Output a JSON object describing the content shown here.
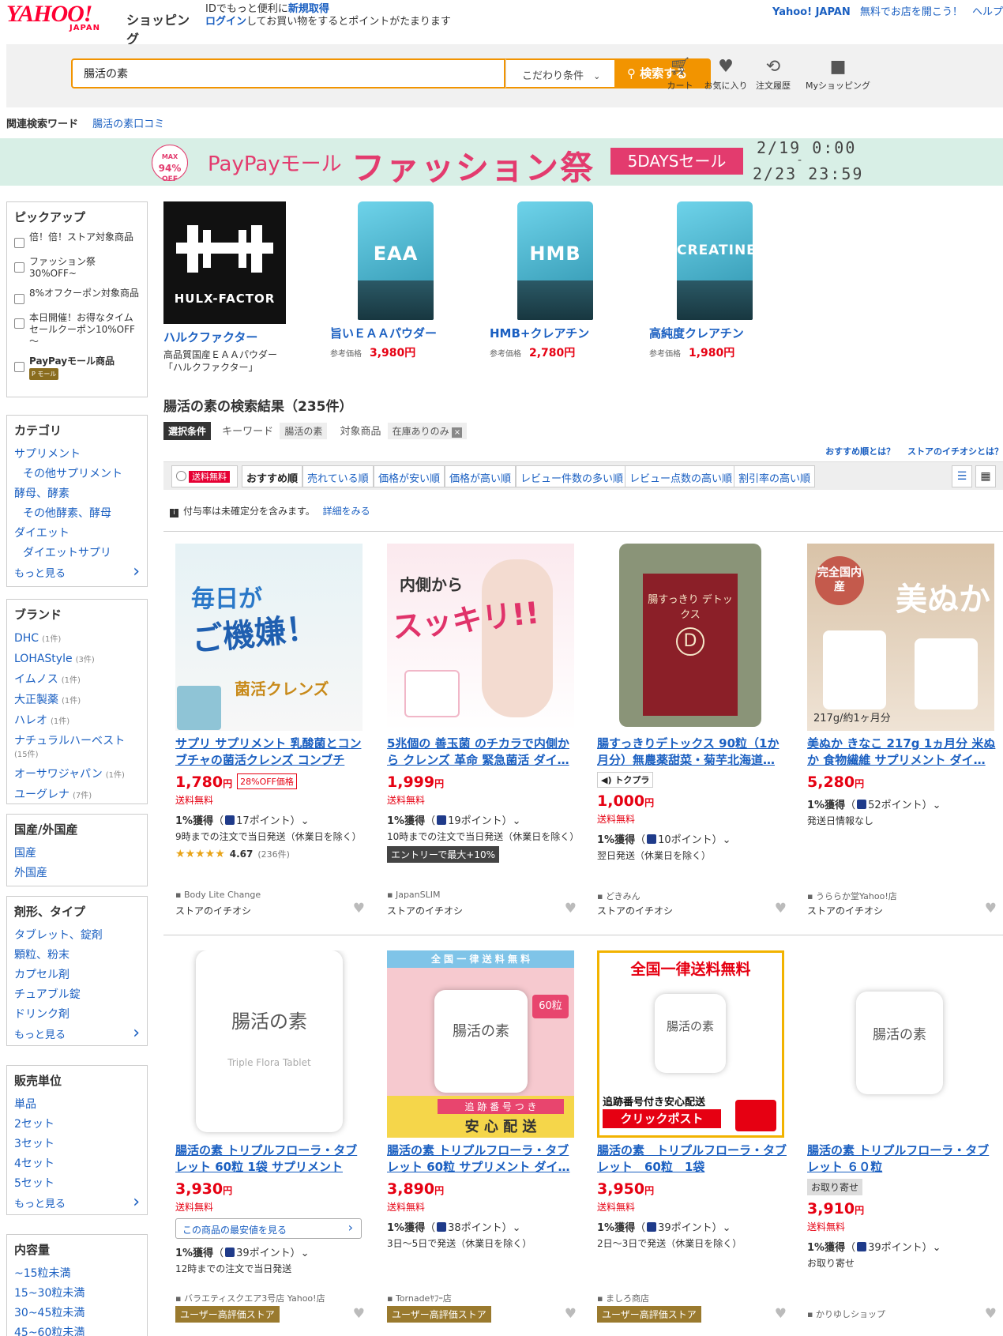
{
  "header": {
    "logo_yahoo": "YAHOO!",
    "logo_japan": "JAPAN",
    "logo_shopping": "ショッピング",
    "promo_line1_pre": "IDでもっと便利に",
    "promo_line1_link": "新規取得",
    "promo_line2_link": "ログイン",
    "promo_line2_post": "してお買い物をするとポイントがたまります",
    "top_links": [
      "Yahoo! JAPAN",
      "無料でお店を開こう！",
      "ヘルプ"
    ]
  },
  "search": {
    "query": "腸活の素",
    "kodawari": "こだわり条件",
    "button": "検索する",
    "icons": [
      {
        "name": "cart-icon",
        "label": "カート"
      },
      {
        "name": "heart-icon",
        "label": "お気に入り"
      },
      {
        "name": "order-history-icon",
        "label": "注文履歴"
      },
      {
        "name": "my-shopping-icon",
        "label": "Myショッピング"
      }
    ]
  },
  "related": {
    "label": "関連検索ワード",
    "word": "腸活の素口コミ"
  },
  "banner": {
    "max": "MAX",
    "pct": "94%",
    "off": "OFF",
    "paypay": "PayPayモール",
    "title": "ファッション祭",
    "sale": "5DAYSセール",
    "date_start": "2/19 0:00",
    "date_sep": "-",
    "date_end": "2/23 23:59"
  },
  "sidebar": {
    "pickup": {
      "title": "ピックアップ",
      "items": [
        "倍！倍！ストア対象商品",
        "ファッション祭30%OFF~",
        "8%オフクーポン対象商品",
        "本日開催！お得なタイムセールクーポン10%OFF～",
        "PayPayモール商品"
      ]
    },
    "category": {
      "title": "カテゴリ",
      "items": [
        {
          "label": "サプリメント",
          "sub": false
        },
        {
          "label": "その他サプリメント",
          "sub": true
        },
        {
          "label": "酵母、酵素",
          "sub": false
        },
        {
          "label": "その他酵素、酵母",
          "sub": true
        },
        {
          "label": "ダイエット",
          "sub": false
        },
        {
          "label": "ダイエットサプリ",
          "sub": true
        }
      ],
      "more": "もっと見る"
    },
    "brand": {
      "title": "ブランド",
      "items": [
        {
          "label": "DHC",
          "count": "(1件)"
        },
        {
          "label": "LOHAStyle",
          "count": "(3件)"
        },
        {
          "label": "イムノス",
          "count": "(1件)"
        },
        {
          "label": "大正製薬",
          "count": "(1件)"
        },
        {
          "label": "ハレオ",
          "count": "(1件)"
        },
        {
          "label": "ナチュラルハーベスト",
          "count": "(15件)"
        },
        {
          "label": "オーサワジャパン",
          "count": "(1件)"
        },
        {
          "label": "ユーグレナ",
          "count": "(7件)"
        }
      ]
    },
    "origin": {
      "title": "国産/外国産",
      "items": [
        "国産",
        "外国産"
      ]
    },
    "form": {
      "title": "剤形、タイプ",
      "items": [
        "タブレット、錠剤",
        "顆粒、粉末",
        "カプセル剤",
        "チュアブル錠",
        "ドリンク剤"
      ],
      "more": "もっと見る"
    },
    "unit": {
      "title": "販売単位",
      "items": [
        "単品",
        "2セット",
        "3セット",
        "4セット",
        "5セット"
      ],
      "more": "もっと見る"
    },
    "amount": {
      "title": "内容量",
      "items": [
        "~15粒未満",
        "15~30粒未満",
        "30~45粒未満",
        "45~60粒未満"
      ]
    }
  },
  "featured": [
    {
      "name": "ハルクファクター",
      "desc": "高品質国産ＥＡＡパウダー「ハルクファクター」",
      "logo_text": "HULX-FACTOR"
    },
    {
      "name": "旨いＥＡＡパウダー",
      "ref": "参考価格",
      "price": "3,980円",
      "pouch": "EAA"
    },
    {
      "name": "HMB+クレアチン",
      "ref": "参考価格",
      "price": "2,780円",
      "pouch": "HMB"
    },
    {
      "name": "高純度クレアチン",
      "ref": "参考価格",
      "price": "1,980円",
      "pouch": "CREATINE"
    }
  ],
  "results": {
    "title": "腸活の素の検索結果（235件）",
    "cond_tag": "選択条件",
    "cond_kw_label": "キーワード",
    "cond_kw": "腸活の素",
    "cond_target_label": "対象商品",
    "cond_target": "在庫ありのみ",
    "help1": "おすすめ順とは？",
    "help2": "ストアのイチオシとは？",
    "free_ship": "送料無料",
    "sorts": [
      "おすすめ順",
      "売れている順",
      "価格が安い順",
      "価格が高い順",
      "レビュー件数の多い順",
      "レビュー点数の高い順",
      "割引率の高い順"
    ],
    "note": "付与率は未確定分を含みます。",
    "note_link": "詳細をみる"
  },
  "products": [
    {
      "title": "サプリ サプリメント 乳酸菌とコンブチャの菌活クレンズ コンブチャ…",
      "price": "1,780",
      "yen": "円",
      "off": "28%OFF価格",
      "ship": "送料無料",
      "pts_pre": "1%獲得",
      "pts": "17ポイント",
      "dlv": "9時までの注文で当日発送（休業日を除く）",
      "rating": "4.67",
      "reviews": "(236件)",
      "seller": "Body Lite Change",
      "ichi": "ストアのイチオシ",
      "img_text1": "毎日が",
      "img_text2": "ご機嫌！",
      "img_text3": "菌活クレンズ"
    },
    {
      "title": "5兆個の 善玉菌 のチカラで内側から クレンズ 革命 緊急菌活 ダイ…",
      "price": "1,999",
      "yen": "円",
      "ship": "送料無料",
      "pts_pre": "1%獲得",
      "pts": "19ポイント",
      "dlv": "10時までの注文で当日発送（休業日を除く）",
      "badge": "エントリーで最大+10%",
      "seller": "JapanSLIM",
      "ichi": "ストアのイチオシ",
      "img_text1": "内側から",
      "img_text2": "スッキリ!!"
    },
    {
      "title": "腸すっきりデトックス 90粒（1か月分）無農薬甜菜・菊芋北海道…",
      "aud": "トクプラ",
      "price": "1,000",
      "yen": "円",
      "ship": "送料無料",
      "pts_pre": "1%獲得",
      "pts": "10ポイント",
      "dlv": "翌日発送（休業日を除く）",
      "seller": "どきみん",
      "ichi": "ストアのイチオシ",
      "img_text1": "腸すっきり デトックス",
      "img_text2": "D"
    },
    {
      "title": "美ぬか きなこ 217g 1ヵ月分 米ぬか 食物繊維 サプリメント ダイ…",
      "price": "5,280",
      "yen": "円",
      "pts_pre": "1%獲得",
      "pts": "52ポイント",
      "dlv": "発送日情報なし",
      "seller": "うららか堂Yahoo!店",
      "ichi": "ストアのイチオシ",
      "img_text1": "完全国内産",
      "img_text2": "美ぬか",
      "img_text3": "217g/約1ヶ月分"
    },
    {
      "title": "腸活の素 トリプルフローラ・タブレット 60粒 1袋 サプリメント",
      "price": "3,930",
      "yen": "円",
      "ship": "送料無料",
      "btnlow": "この商品の最安値を見る",
      "pts_pre": "1%獲得",
      "pts": "39ポイント",
      "dlv": "12時までの注文で当日発送",
      "seller": "バラエティスクエア3号店 Yahoo!店",
      "hyo": "ユーザー高評価ストア",
      "img_text1": "腸活の素",
      "img_text2": "Triple Flora Tablet"
    },
    {
      "title": "腸活の素 トリプルフローラ・タブレット 60粒 サプリメント ダイ…",
      "price": "3,890",
      "yen": "円",
      "ship": "送料無料",
      "pts_pre": "1%獲得",
      "pts": "38ポイント",
      "dlv": "3日～5日で発送（休業日を除く）",
      "seller": "Tornadeﾔﾌｰ店",
      "hyo": "ユーザー高評価ストア",
      "img_text1": "全 国 一 律 送 料 無 料",
      "img_text2": "腸活の素",
      "img_text3": "追 跡 番 号 つ き",
      "img_text4": "安 心 配 送",
      "img_text5": "60粒"
    },
    {
      "title": "腸活の素　トリプルフローラ・タブレット　60粒　1袋",
      "price": "3,950",
      "yen": "円",
      "ship": "送料無料",
      "pts_pre": "1%獲得",
      "pts": "39ポイント",
      "dlv": "2日～3日で発送（休業日を除く）",
      "seller": "ましろ商店",
      "hyo": "ユーザー高評価ストア",
      "img_text1": "全国一律送料無料",
      "img_text2": "腸活の素",
      "img_text3": "追跡番号付き安心配送",
      "img_text4": "クリックポスト"
    },
    {
      "title": "腸活の素 トリプルフローラ・タブレット ６０粒",
      "yose": "お取り寄せ",
      "price": "3,910",
      "yen": "円",
      "ship": "送料無料",
      "pts_pre": "1%獲得",
      "pts": "39ポイント",
      "dlv": "お取り寄せ",
      "seller": "かりゆしショップ",
      "img_text1": "腸活の素"
    }
  ]
}
